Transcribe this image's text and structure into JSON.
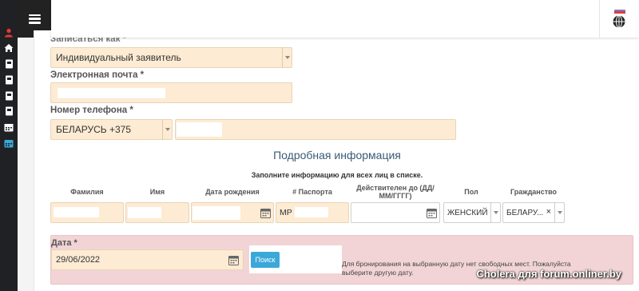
{
  "sidebar": {
    "top_text": "",
    "icons": [
      "user-icon",
      "home-icon",
      "book-icon",
      "book-icon",
      "book-icon",
      "book-icon",
      "calendar-icon",
      "calendar-icon"
    ]
  },
  "header": {
    "menu_icon": "hamburger-icon",
    "globe_icon": "globe-icon"
  },
  "form": {
    "register_as": {
      "label": "Записаться как *",
      "value": "Индивидуальный заявитель"
    },
    "email": {
      "label": "Электронная почта *",
      "value": ""
    },
    "phone": {
      "label": "Номер телефона *",
      "country": "БЕЛАРУСЬ +375",
      "number": ""
    }
  },
  "details": {
    "title": "Подробная информация",
    "subtitle": "Заполните информацию для всех лиц в списке.",
    "columns": [
      "Фамилия",
      "Имя",
      "Дата рождения",
      "# Паспорта",
      "Действителен до (ДД/ММ/ГГГГ)",
      "Пол",
      "Гражданство"
    ],
    "row": {
      "surname": "",
      "name": "",
      "birth_date": "",
      "passport": "MP",
      "valid_until": "",
      "gender": "ЖЕНСКИЙ",
      "citizenship": "БЕЛАРУ...",
      "clear_symbol": "×"
    }
  },
  "date_section": {
    "label": "Дата *",
    "value": "29/06/2022",
    "search_label": "Поиск",
    "notice": "Для бронирования на выбранную дату нет свободных мест. Пожалуйста выберите другую дату."
  },
  "watermark": "Cholera для forum.onliner.by",
  "colors": {
    "field_bg": "#fdebd3",
    "alert_bg": "#f2d4d6",
    "button": "#3aa8d8",
    "sidebar": "#202124"
  }
}
